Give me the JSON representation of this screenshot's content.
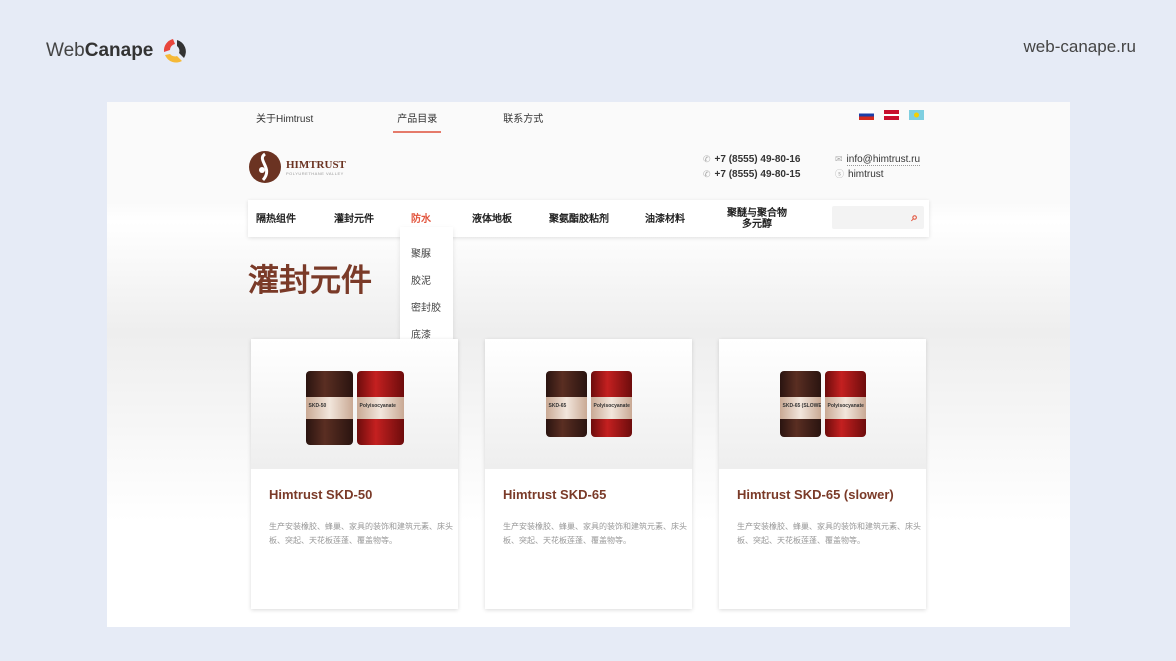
{
  "frame": {
    "brand_prefix": "Web",
    "brand_bold": "Canape",
    "site": "web-canape.ru"
  },
  "topnav": [
    "关于Himtrust",
    "产品目录",
    "联系方式"
  ],
  "logo": {
    "name": "HIMTRUST",
    "tagline": "POLYURETHANE VALLEY"
  },
  "contacts": {
    "phone1": "+7 (8555) 49-80-16",
    "phone2": "+7 (8555) 49-80-15",
    "email": "info@himtrust.ru",
    "skype": "himtrust"
  },
  "menu": [
    "隔热组件",
    "灌封元件",
    "防水",
    "液体地板",
    "聚氨酯胶粘剂",
    "油漆材料",
    "聚醚与聚合物多元醇"
  ],
  "dropdown": [
    "聚脲",
    "胶泥",
    "密封胶",
    "底漆"
  ],
  "page_title": "灌封元件",
  "products": [
    {
      "title": "Himtrust SKD-50",
      "label1": "SKD-50",
      "label2": "Polyisocyanate",
      "desc": "生产安装橡胶、蜂巢、家具的装饰和建筑元素、床头板、突起、天花板莲蓬、覆盖物等。"
    },
    {
      "title": "Himtrust SKD-65",
      "label1": "SKD-65",
      "label2": "Polyisocyanate",
      "desc": "生产安装橡胶、蜂巢、家具的装饰和建筑元素、床头板、突起、天花板莲蓬、覆盖物等。"
    },
    {
      "title": "Himtrust SKD-65 (slower)",
      "label1": "SKD-65 (SLOWER)",
      "label2": "Polyisocyanate",
      "desc": "生产安装橡胶、蜂巢、家具的装饰和建筑元素、床头板、突起、天花板莲蓬、覆盖物等。"
    }
  ]
}
